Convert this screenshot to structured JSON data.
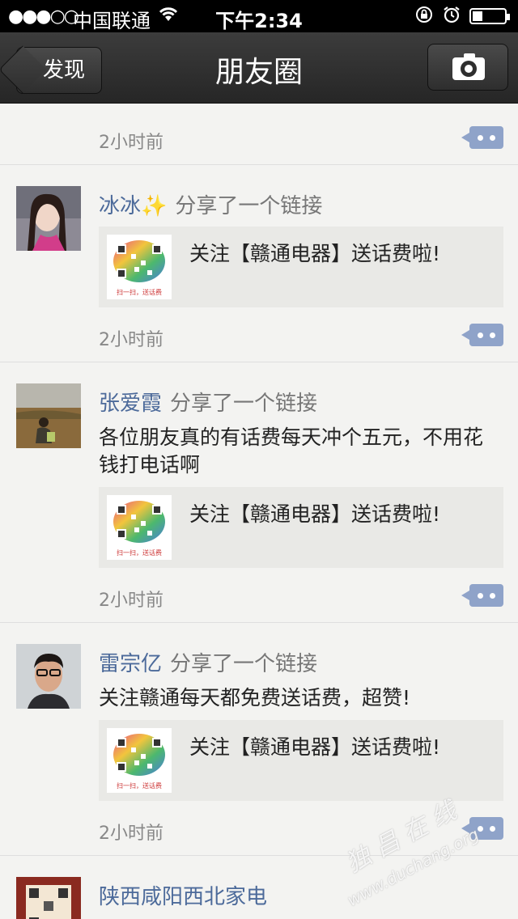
{
  "status_bar": {
    "signal": "●●●○○",
    "carrier": "中国联通",
    "time": "下午2:34"
  },
  "nav": {
    "back_label": "发现",
    "title": "朋友圈"
  },
  "feed": {
    "top_partial": {
      "time": "2小时前"
    },
    "posts": [
      {
        "name": "冰冰✨",
        "action": "分享了一个链接",
        "text": "",
        "link_title": "关注【赣通电器】送话费啦!",
        "thumb_caption": "扫一扫，送话费",
        "time": "2小时前"
      },
      {
        "name": "张爱霞",
        "action": "分享了一个链接",
        "text": "各位朋友真的有话费每天冲个五元，不用花钱打电话啊",
        "link_title": "关注【赣通电器】送话费啦!",
        "thumb_caption": "扫一扫，送话费",
        "time": "2小时前"
      },
      {
        "name": "雷宗亿",
        "action": "分享了一个链接",
        "text": "关注赣通每天都免费送话费，超赞!",
        "link_title": "关注【赣通电器】送话费啦!",
        "thumb_caption": "扫一扫，送话费",
        "time": "2小时前"
      },
      {
        "name": "陕西咸阳西北家电",
        "action": ""
      }
    ]
  },
  "watermark": {
    "line1": "独 昌 在 线",
    "line2": "www.duchang.org"
  }
}
